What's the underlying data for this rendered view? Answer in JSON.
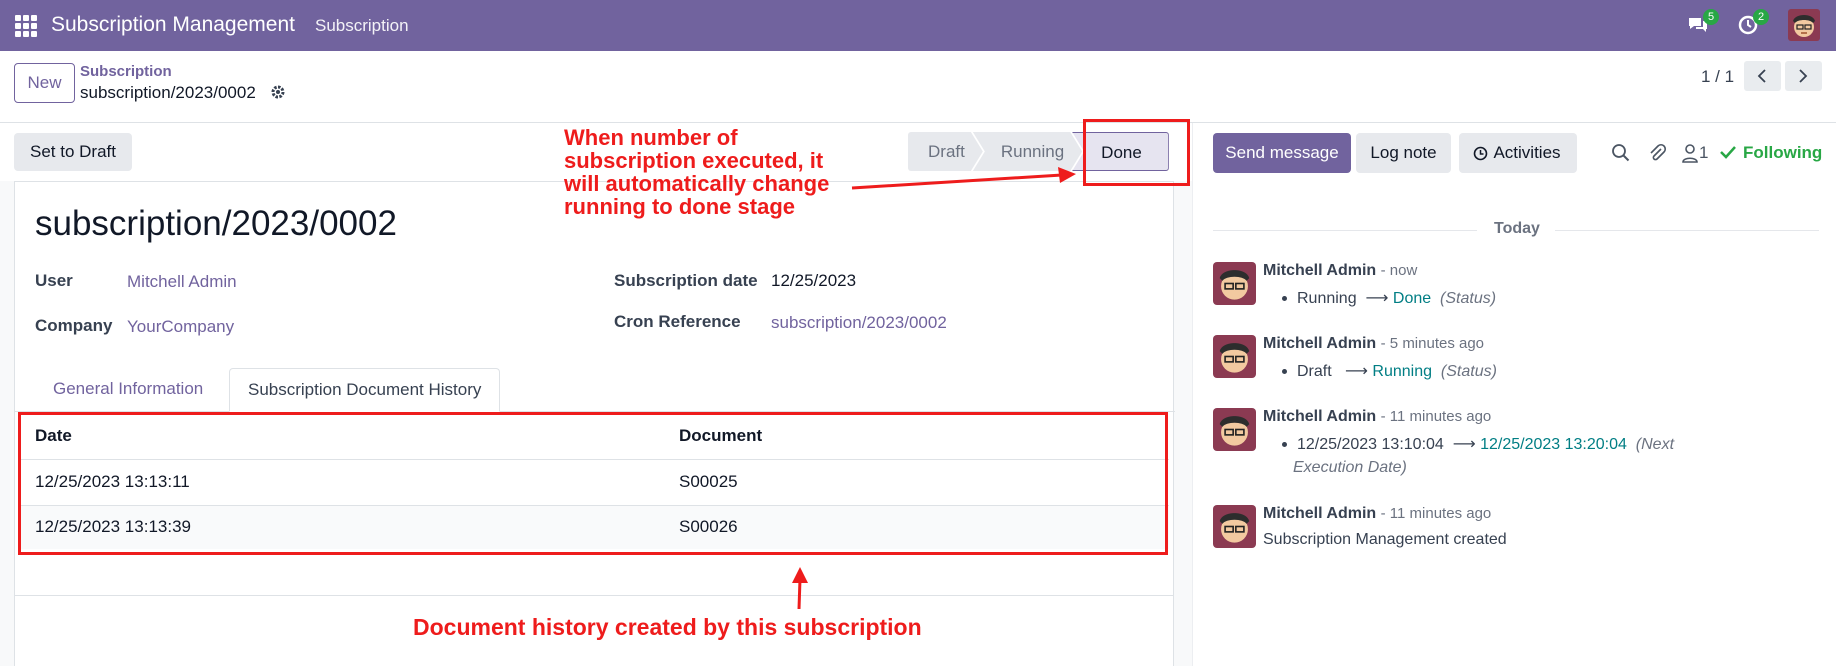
{
  "topbar": {
    "app_title": "Subscription Management",
    "menu_item": "Subscription",
    "messages_count": "5",
    "activities_count": "2",
    "bg_color": "#71639e"
  },
  "control_panel": {
    "new_label": "New",
    "breadcrumb_parent": "Subscription",
    "breadcrumb_current": "subscription/2023/0002",
    "pager": "1 / 1"
  },
  "statusbar": {
    "set_draft_label": "Set to Draft",
    "stages": [
      "Draft",
      "Running",
      "Done"
    ],
    "active_stage": "Done"
  },
  "form": {
    "title": "subscription/2023/0002",
    "user_label": "User",
    "user_value": "Mitchell Admin",
    "company_label": "Company",
    "company_value": "YourCompany",
    "date_label": "Subscription date",
    "date_value": "12/25/2023",
    "cron_label": "Cron Reference",
    "cron_value": "subscription/2023/0002",
    "tabs": [
      "General Information",
      "Subscription Document History"
    ],
    "active_tab": "Subscription Document History",
    "history": {
      "columns": [
        "Date",
        "Document"
      ],
      "rows": [
        {
          "date": "12/25/2023 13:13:11",
          "document": "S00025"
        },
        {
          "date": "12/25/2023 13:13:39",
          "document": "S00026"
        }
      ]
    }
  },
  "chatter": {
    "send_message_label": "Send message",
    "log_note_label": "Log note",
    "activities_label": "Activities",
    "followers_count": "1",
    "following_label": "Following",
    "today_label": "Today",
    "messages": [
      {
        "author": "Mitchell Admin",
        "when": "- now",
        "old": "Running",
        "new": "Done",
        "field": "(Status)"
      },
      {
        "author": "Mitchell Admin",
        "when": "- 5 minutes ago",
        "old": "Draft",
        "new": "Running",
        "field": "(Status)"
      },
      {
        "author": "Mitchell Admin",
        "when": "- 11 minutes ago",
        "old": "12/25/2023 13:10:04",
        "new": "12/25/2023 13:20:04",
        "field": "(Next",
        "field_cont": "Execution Date)"
      },
      {
        "author": "Mitchell Admin",
        "when": "- 11 minutes ago",
        "body": "Subscription Management created"
      }
    ]
  },
  "annotations": {
    "top_note_lines": [
      "When number of",
      "subscription executed, it",
      "will automatically change",
      "running to done stage"
    ],
    "bottom_note": "Document history created by this subscription",
    "color": "#ee1c1c"
  }
}
